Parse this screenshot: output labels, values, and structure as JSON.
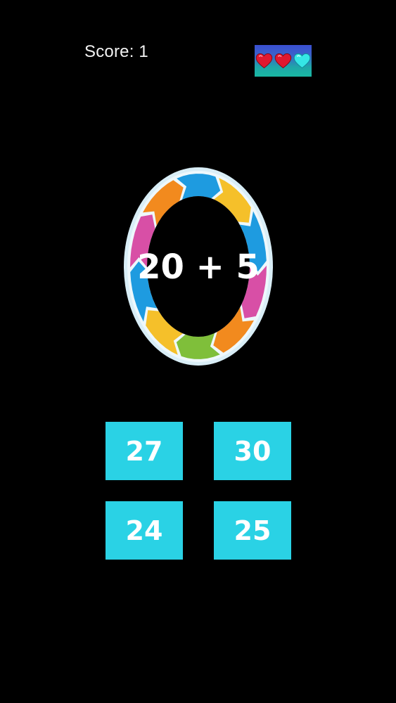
{
  "hud": {
    "score_text": "Score: 1",
    "lives": [
      {
        "icon": "heart-icon",
        "color": "#e0182f",
        "state": "full"
      },
      {
        "icon": "heart-icon",
        "color": "#e0182f",
        "state": "full"
      },
      {
        "icon": "heart-icon",
        "color": "#2fe0e0",
        "state": "empty"
      }
    ]
  },
  "question": {
    "text": "20 + 5"
  },
  "answers": [
    "27",
    "30",
    "24",
    "25"
  ],
  "colors": {
    "background": "#000000",
    "button": "#2ad2e5",
    "wheel_segments": [
      "#1e9be0",
      "#f5c02a",
      "#d84fa6",
      "#f28a1e",
      "#7fbf3a",
      "#a64fc6"
    ]
  }
}
